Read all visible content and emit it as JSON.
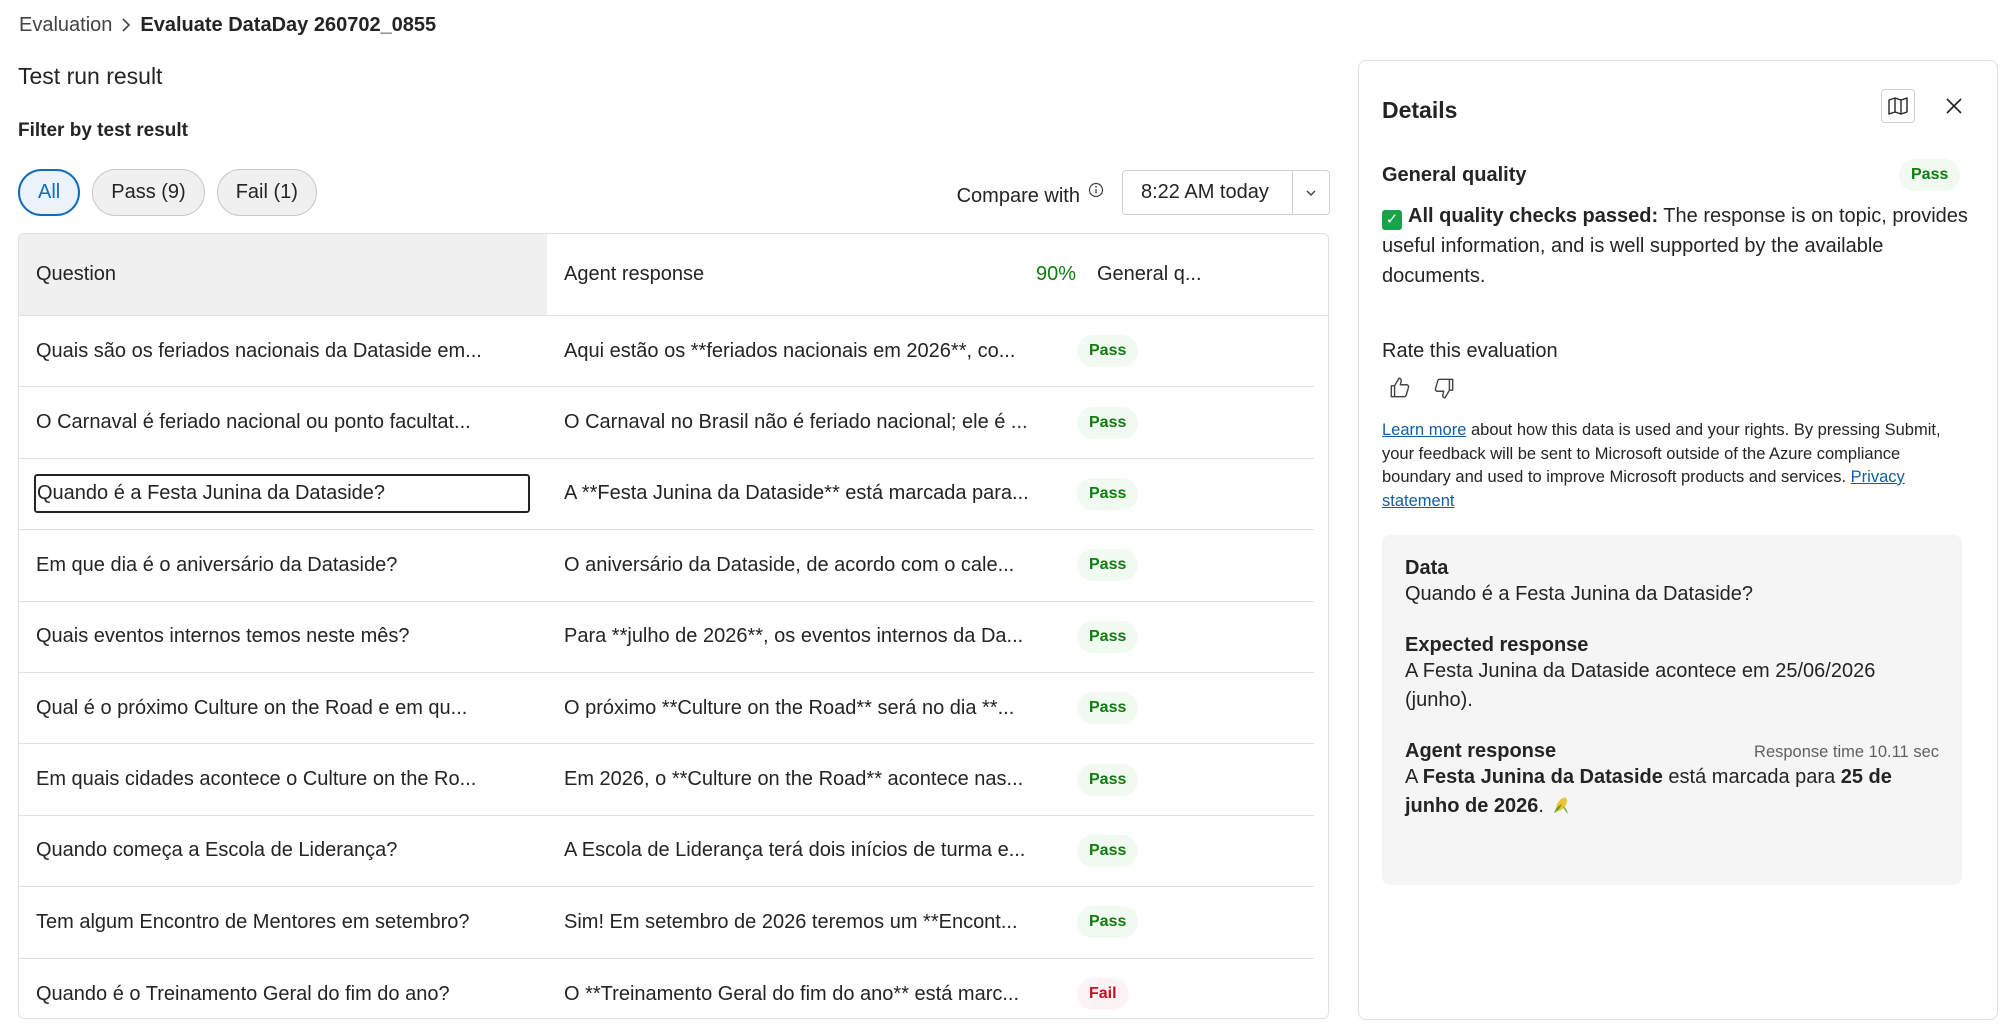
{
  "breadcrumb": {
    "root": "Evaluation",
    "current": "Evaluate DataDay 260702_0855"
  },
  "page_title": "Test run result",
  "filter_label": "Filter by test result",
  "filters": {
    "all": "All",
    "pass": "Pass (9)",
    "fail": "Fail (1)"
  },
  "compare": {
    "label": "Compare with",
    "value": "8:22 AM today"
  },
  "table": {
    "headers": {
      "question": "Question",
      "response": "Agent response",
      "percent": "90%",
      "quality": "General q..."
    },
    "rows": [
      {
        "question": "Quais são os feriados nacionais da Dataside em...",
        "response": "Aqui estão os **feriados nacionais em 2026**, co...",
        "result": "Pass"
      },
      {
        "question": "O Carnaval é feriado nacional ou ponto facultat...",
        "response": "O Carnaval no Brasil não é feriado nacional; ele é ...",
        "result": "Pass"
      },
      {
        "question": "Quando é a Festa Junina da Dataside?",
        "response": "A **Festa Junina da Dataside** está marcada para...",
        "result": "Pass"
      },
      {
        "question": "Em que dia é o aniversário da Dataside?",
        "response": "O aniversário da Dataside, de acordo com o cale...",
        "result": "Pass"
      },
      {
        "question": "Quais eventos internos temos neste mês?",
        "response": "Para **julho de 2026**, os eventos internos da Da...",
        "result": "Pass"
      },
      {
        "question": "Qual é o próximo Culture on the Road e em qu...",
        "response": "O próximo **Culture on the Road** será no dia **...",
        "result": "Pass"
      },
      {
        "question": "Em quais cidades acontece o Culture on the Ro...",
        "response": "Em 2026, o **Culture on the Road** acontece nas...",
        "result": "Pass"
      },
      {
        "question": "Quando começa a Escola de Liderança?",
        "response": "A Escola de Liderança terá dois inícios de turma e...",
        "result": "Pass"
      },
      {
        "question": "Tem algum Encontro de Mentores em setembro?",
        "response": "Sim! Em setembro de 2026 teremos um **Encont...",
        "result": "Pass"
      },
      {
        "question": "Quando é o Treinamento Geral do fim do ano?",
        "response": "O **Treinamento Geral do fim do ano** está marc...",
        "result": "Fail"
      }
    ]
  },
  "details": {
    "title": "Details",
    "general_quality_label": "General quality",
    "general_quality_result": "Pass",
    "checks_bold": "All quality checks passed:",
    "checks_text": " The response is on topic, provides useful information, and is well supported by the available documents.",
    "rate_label": "Rate this evaluation",
    "disclaimer_link": "Learn more",
    "disclaimer_text": " about how this data is used and your rights. By pressing Submit, your feedback will be sent to Microsoft outside of the Azure compliance boundary and used to improve Microsoft products and services. ",
    "privacy_link": "Privacy statement",
    "data_label": "Data",
    "data_value": "Quando é a Festa Junina da Dataside?",
    "expected_label": "Expected response",
    "expected_value": "A Festa Junina da Dataside acontece em 25/06/2026 (junho).",
    "agent_label": "Agent response",
    "response_time": "Response time 10.11 sec",
    "agent_part1": "A ",
    "agent_bold1": "Festa Junina da Dataside",
    "agent_part2": " está marcada para ",
    "agent_bold2": "25 de junho de 2026",
    "agent_part3": ". "
  },
  "colors": {
    "accent": "#0f6cbd",
    "pass": "#107c10",
    "fail": "#c50f1f"
  },
  "icons": [
    "chevron-right-icon",
    "info-icon",
    "chevron-down-icon",
    "map-icon",
    "close-icon",
    "check-icon",
    "thumbs-up-icon",
    "thumbs-down-icon",
    "corn-icon"
  ]
}
